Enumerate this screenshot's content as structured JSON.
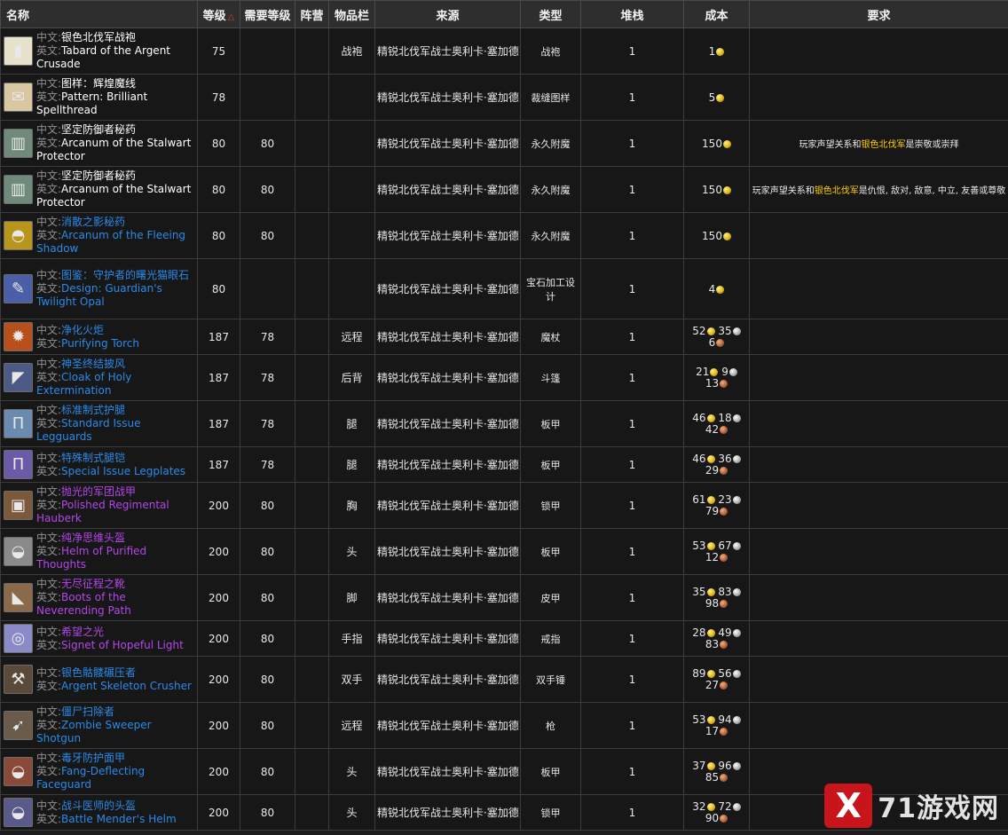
{
  "headers": {
    "name": "名称",
    "level": "等级",
    "required_level": "需要等级",
    "faction": "阵营",
    "slot": "物品栏",
    "source": "来源",
    "type": "类型",
    "stack": "堆栈",
    "cost": "成本",
    "requirement": "要求"
  },
  "labels": {
    "cn": "中文:",
    "en": "英文:"
  },
  "watermark": {
    "text": "71游戏网",
    "mark": "X"
  },
  "rows": [
    {
      "cn": "银色北伐军战袍",
      "en": "Tabard of the Argent Crusade",
      "quality": "white",
      "icon": "tabard-icon",
      "glyph": "▮",
      "bg": "#e8e2cc",
      "level": "75",
      "req": "",
      "slot": "战袍",
      "source": "精锐北伐军战士奥利卡·塞加德",
      "type": "战袍",
      "stack": "1",
      "gold": "1",
      "silver": "",
      "copper": "",
      "requirement": ""
    },
    {
      "cn": "图样：辉煌魔线",
      "en": "Pattern: Brilliant Spellthread",
      "quality": "white",
      "icon": "scroll-icon",
      "glyph": "✉",
      "bg": "#d8c7a0",
      "level": "78",
      "req": "",
      "slot": "",
      "source": "精锐北伐军战士奥利卡·塞加德",
      "type": "裁缝图样",
      "stack": "1",
      "gold": "5",
      "silver": "",
      "copper": "",
      "requirement": ""
    },
    {
      "cn": "坚定防御者秘药",
      "en": "Arcanum of the Stalwart Protector",
      "quality": "white",
      "icon": "arcanum-icon",
      "glyph": "▥",
      "bg": "#6f8a7a",
      "level": "80",
      "req": "80",
      "slot": "",
      "source": "精锐北伐军战士奥利卡·塞加德",
      "type": "永久附魔",
      "stack": "1",
      "gold": "150",
      "silver": "",
      "copper": "",
      "requirement": {
        "pre": "玩家声望关系和",
        "hl": "银色北伐军",
        "post": "是崇敬或崇拜"
      }
    },
    {
      "cn": "坚定防御者秘药",
      "en": "Arcanum of the Stalwart Protector",
      "quality": "white",
      "icon": "arcanum-icon",
      "glyph": "▥",
      "bg": "#6f8a7a",
      "level": "80",
      "req": "80",
      "slot": "",
      "source": "精锐北伐军战士奥利卡·塞加德",
      "type": "永久附魔",
      "stack": "1",
      "gold": "150",
      "silver": "",
      "copper": "",
      "requirement": {
        "pre": "玩家声望关系和",
        "hl": "银色北伐军",
        "post": "是仇恨, 敌对, 敌意, 中立, 友善或尊敬"
      }
    },
    {
      "cn": "消散之影秘药",
      "en": "Arcanum of the Fleeing Shadow",
      "quality": "blue",
      "icon": "helm-icon",
      "glyph": "◓",
      "bg": "#b8961c",
      "level": "80",
      "req": "80",
      "slot": "",
      "source": "精锐北伐军战士奥利卡·塞加德",
      "type": "永久附魔",
      "stack": "1",
      "gold": "150",
      "silver": "",
      "copper": "",
      "requirement": ""
    },
    {
      "cn": "图鉴：守护者的曙光猫眼石",
      "en": "Design: Guardian's Twilight Opal",
      "quality": "blue",
      "icon": "design-icon",
      "glyph": "✎",
      "bg": "#4a5fa8",
      "level": "80",
      "req": "",
      "slot": "",
      "source": "精锐北伐军战士奥利卡·塞加德",
      "type": "宝石加工设计",
      "stack": "1",
      "gold": "4",
      "silver": "",
      "copper": "",
      "requirement": ""
    },
    {
      "cn": "净化火炬",
      "en": "Purifying Torch",
      "quality": "blue",
      "icon": "torch-icon",
      "glyph": "✹",
      "bg": "#b8501c",
      "level": "187",
      "req": "78",
      "slot": "远程",
      "source": "精锐北伐军战士奥利卡·塞加德",
      "type": "魔杖",
      "stack": "1",
      "gold": "52",
      "silver": "35",
      "copper": "6",
      "requirement": ""
    },
    {
      "cn": "神圣终结披风",
      "en": "Cloak of Holy Extermination",
      "quality": "blue",
      "icon": "cloak-icon",
      "glyph": "◤",
      "bg": "#4c5a86",
      "level": "187",
      "req": "78",
      "slot": "后背",
      "source": "精锐北伐军战士奥利卡·塞加德",
      "type": "斗篷",
      "stack": "1",
      "gold": "21",
      "silver": "9",
      "copper": "13",
      "requirement": ""
    },
    {
      "cn": "标准制式护腿",
      "en": "Standard Issue Legguards",
      "quality": "blue",
      "icon": "legs-icon",
      "glyph": "Π",
      "bg": "#6a8ab0",
      "level": "187",
      "req": "78",
      "slot": "腿",
      "source": "精锐北伐军战士奥利卡·塞加德",
      "type": "板甲",
      "stack": "1",
      "gold": "46",
      "silver": "18",
      "copper": "42",
      "requirement": ""
    },
    {
      "cn": "特殊制式腿铠",
      "en": "Special Issue Legplates",
      "quality": "blue",
      "icon": "legs-icon",
      "glyph": "Π",
      "bg": "#6a5aa8",
      "level": "187",
      "req": "78",
      "slot": "腿",
      "source": "精锐北伐军战士奥利卡·塞加德",
      "type": "板甲",
      "stack": "1",
      "gold": "46",
      "silver": "36",
      "copper": "29",
      "requirement": ""
    },
    {
      "cn": "抛光的军团战甲",
      "en": "Polished Regimental Hauberk",
      "quality": "purple",
      "icon": "chest-icon",
      "glyph": "▣",
      "bg": "#7a5a3a",
      "level": "200",
      "req": "80",
      "slot": "胸",
      "source": "精锐北伐军战士奥利卡·塞加德",
      "type": "锁甲",
      "stack": "1",
      "gold": "61",
      "silver": "23",
      "copper": "79",
      "requirement": ""
    },
    {
      "cn": "纯净思维头盔",
      "en": "Helm of Purified Thoughts",
      "quality": "purple",
      "icon": "helm-icon",
      "glyph": "◒",
      "bg": "#8a8a8a",
      "level": "200",
      "req": "80",
      "slot": "头",
      "source": "精锐北伐军战士奥利卡·塞加德",
      "type": "板甲",
      "stack": "1",
      "gold": "53",
      "silver": "67",
      "copper": "12",
      "requirement": ""
    },
    {
      "cn": "无尽征程之靴",
      "en": "Boots of the Neverending Path",
      "quality": "purple",
      "icon": "boots-icon",
      "glyph": "◣",
      "bg": "#8a6a4a",
      "level": "200",
      "req": "80",
      "slot": "脚",
      "source": "精锐北伐军战士奥利卡·塞加德",
      "type": "皮甲",
      "stack": "1",
      "gold": "35",
      "silver": "83",
      "copper": "98",
      "requirement": ""
    },
    {
      "cn": "希望之光",
      "en": "Signet of Hopeful Light",
      "quality": "purple",
      "icon": "ring-icon",
      "glyph": "◎",
      "bg": "#8a8ac8",
      "level": "200",
      "req": "80",
      "slot": "手指",
      "source": "精锐北伐军战士奥利卡·塞加德",
      "type": "戒指",
      "stack": "1",
      "gold": "28",
      "silver": "49",
      "copper": "83",
      "requirement": ""
    },
    {
      "cn": "银色骷髅碾压者",
      "en": "Argent Skeleton Crusher",
      "quality": "blue",
      "icon": "mace-icon",
      "glyph": "⚒",
      "bg": "#5a4a3a",
      "level": "200",
      "req": "80",
      "slot": "双手",
      "source": "精锐北伐军战士奥利卡·塞加德",
      "type": "双手锤",
      "stack": "1",
      "gold": "89",
      "silver": "56",
      "copper": "27",
      "requirement": ""
    },
    {
      "cn": "僵尸扫除者",
      "en": "Zombie Sweeper Shotgun",
      "quality": "blue",
      "icon": "gun-icon",
      "glyph": "➹",
      "bg": "#6a5a4a",
      "level": "200",
      "req": "80",
      "slot": "远程",
      "source": "精锐北伐军战士奥利卡·塞加德",
      "type": "枪",
      "stack": "1",
      "gold": "53",
      "silver": "94",
      "copper": "17",
      "requirement": ""
    },
    {
      "cn": "毒牙防护面甲",
      "en": "Fang-Deflecting Faceguard",
      "quality": "blue",
      "icon": "helm-icon",
      "glyph": "◒",
      "bg": "#8a4a3a",
      "level": "200",
      "req": "80",
      "slot": "头",
      "source": "精锐北伐军战士奥利卡·塞加德",
      "type": "板甲",
      "stack": "1",
      "gold": "37",
      "silver": "96",
      "copper": "85",
      "requirement": ""
    },
    {
      "cn": "战斗医师的头盔",
      "en": "Battle Mender's Helm",
      "quality": "blue",
      "icon": "helm-icon",
      "glyph": "◒",
      "bg": "#5a5a8a",
      "level": "200",
      "req": "80",
      "slot": "头",
      "source": "精锐北伐军战士奥利卡·塞加德",
      "type": "锁甲",
      "stack": "1",
      "gold": "32",
      "silver": "72",
      "copper": "90",
      "requirement": ""
    }
  ]
}
